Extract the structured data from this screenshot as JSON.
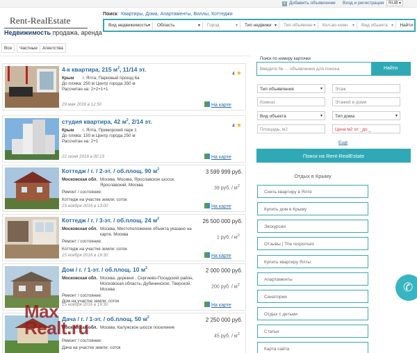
{
  "topbar": {
    "add_listing": "Добавить объявление",
    "login": "Вход и регистрация",
    "currency": "RUB"
  },
  "logo": {
    "name": "Rent-RealEstate",
    "sub_bold": "Недвижимость",
    "sub_rest": " продажа, аренда"
  },
  "search": {
    "label": "Поиск",
    "links": "Квартиры, Дома, Апартаменты, Виллы, Коттеджи",
    "fields": [
      "Вид недвижимость",
      "Область",
      "Город",
      "Тип недвижи",
      "Тип объявлен",
      "Кол-во комн",
      "Вид объекта"
    ],
    "button": "Найти"
  },
  "tabs": [
    "Все",
    "Частные",
    "Агентства"
  ],
  "listings": [
    {
      "title": "4-к квартира, 215 м",
      "title_sup": "2",
      "title_rest": ", 11/14 эт.",
      "region": "Крым",
      "addr": "г. Ялта, Парковый проезд 6а",
      "line1": "До пляжа: 250 м      Центр города 350 м",
      "line2": "Рассчитан на: 2+2+1+1",
      "date": "29 мая 2016 в 12:50",
      "rating": "4",
      "map": "На карте"
    },
    {
      "title": "студия квартира, 42 м",
      "title_sup": "2",
      "title_rest": ", 2/14 эт.",
      "region": "Крым",
      "addr": "г. Ялта, Приморский парк 1",
      "line1": "До пляжа: 150 м      Центр города 250 м",
      "line2": "Рассчитан на: 2+1",
      "date": "22 июня 2016 в 00:13",
      "rating": "4",
      "map": "На карте"
    },
    {
      "title": "Коттедж / г. / 2-эт. / об.площ. 90 м",
      "title_sup": "2",
      "title_rest": "",
      "region": "Московская обл.",
      "addr": "Москва, Москва, Ярославское шоссе, Ярославский, Москва",
      "line1": "Ремонт / состояние:",
      "line2": "Коттедж на участке земли: соток",
      "date": "23 ноября 2016 в 13:00",
      "price": "3 599 999 руб.",
      "sqm": "39 руб. / м",
      "map": "На карте"
    },
    {
      "title": "Коттедж / г. / 3-эт. / об.площ. 24 м",
      "title_sup": "2",
      "title_rest": "",
      "region": "Московская обл.",
      "addr": "Москва, Местоположение объекта указано на карте, Москва",
      "line1": "Ремонт / состояние:",
      "line2": "Коттедж на участке земли: соток",
      "date": "15 ноября 2016 в 19:30",
      "price": "26 500 000 руб.",
      "sqm": "1 руб. / м",
      "map": "На карте"
    },
    {
      "title": "Дом / г. / 1-эт. / об.площ. 10 м",
      "title_sup": "2",
      "title_rest": "",
      "region": "Московская обл.",
      "addr": "Москва, деревня , Сергиево-Посадский район, Московская область, Дубининское, Тверской, Москва",
      "line1": "Ремонт / состояние:",
      "line2": "Дом на участке земли: соток",
      "date": "15 ноября 2016 в 19:30",
      "price": "2 000 000 руб.",
      "sqm": "200 руб. / м",
      "map": "На карте"
    },
    {
      "title": "Дача / г. / 1-эт. / об.площ. 50 м",
      "title_sup": "2",
      "title_rest": "",
      "region": "Московская обл.",
      "addr": "Москва, Калужское шоссе поселение",
      "line1": "Ремонт / состояние:",
      "line2": "Дача на участке земли: соток",
      "date": "",
      "price": "2 250 000 руб.",
      "sqm": "45 руб. / м",
      "map": "На карте"
    }
  ],
  "right_panel": {
    "card_label": "Поиск по номеру карточки",
    "card_placeholder": "Введите № ... объявления для поиска",
    "card_button": "Найти",
    "fields": {
      "type": "Тип объявления",
      "floor": "Этаж",
      "rooms": "Комнат",
      "floors": "Этажей в доме",
      "object": "Вид объекта",
      "house": "Тип дома",
      "area": "Площадь, м2",
      "price_m2": "Цена м2 от _до _"
    },
    "more": "Ещё",
    "submit": "Поиск на Rent-RealEstate",
    "rest_title": "Отдых в Крыму",
    "links": [
      "Снять квартиру в Ялте",
      "Купить дом в Крыму",
      "Экскурсии",
      "Отзывы | The responses",
      "Купить квартиру Ялты",
      "Апартаменты",
      "Санатории",
      "Отдых с детьми",
      "Статьи",
      "Карта сайта"
    ]
  },
  "watermark": {
    "line1": "Max",
    "line2": "Realt.ru"
  },
  "colors": {
    "accent": "#2fa9b6",
    "link": "#2a6aa0",
    "star": "#f3b21b",
    "red": "#d33333"
  }
}
